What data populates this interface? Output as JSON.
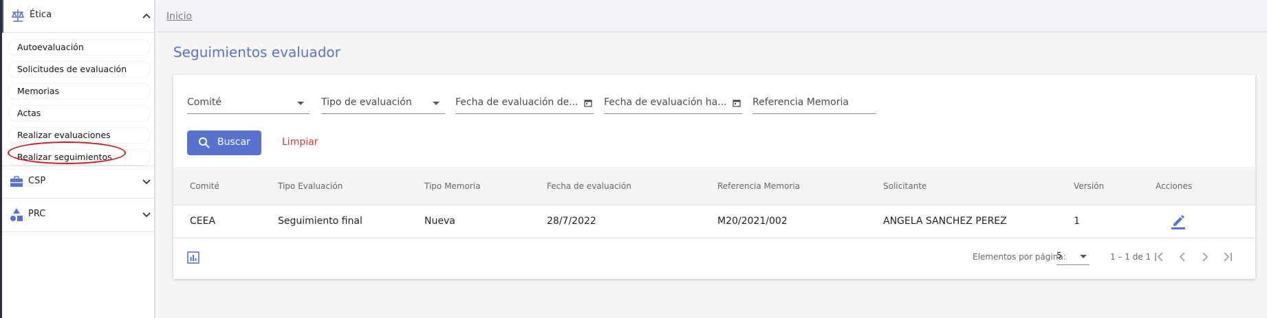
{
  "sidebar": {
    "sections": [
      {
        "label": "Ética",
        "icon": "scales-icon",
        "expanded": true
      },
      {
        "label": "CSP",
        "icon": "briefcase-icon",
        "expanded": false
      },
      {
        "label": "PRC",
        "icon": "shapes-icon",
        "expanded": false
      }
    ],
    "etica_items": [
      {
        "label": "Autoevaluación"
      },
      {
        "label": "Solicitudes de evaluación"
      },
      {
        "label": "Memorias"
      },
      {
        "label": "Actas"
      },
      {
        "label": "Realizar evaluaciones"
      },
      {
        "label": "Realizar seguimientos",
        "highlighted": true
      }
    ]
  },
  "header": {
    "breadcrumb": "Inicio"
  },
  "page": {
    "title": "Seguimientos evaluador"
  },
  "filters": {
    "comite": "Comité",
    "tipo_evaluacion": "Tipo de evaluación",
    "fecha_desde": "Fecha de evaluación de...",
    "fecha_hasta": "Fecha de evaluación ha...",
    "referencia_memoria": "Referencia Memoria"
  },
  "actions": {
    "search_label": "Buscar",
    "clear_label": "Limpiar"
  },
  "table": {
    "columns": [
      "Comité",
      "Tipo Evaluación",
      "Tipo Memoria",
      "Fecha de evaluación",
      "Referencia Memoria",
      "Solicitante",
      "Versión",
      "Acciones"
    ],
    "rows": [
      [
        "CEEA",
        "Seguimiento final",
        "Nueva",
        "28/7/2022",
        "M20/2021/002",
        "ANGELA SANCHEZ PEREZ",
        "1"
      ]
    ]
  },
  "paginator": {
    "items_per_page_label": "Elementos por página:",
    "items_per_page_value": "5",
    "range_label": "1 – 1 de 1"
  },
  "colors": {
    "accent": "#5873cf",
    "title": "#5a72c9",
    "danger": "#d93a2b",
    "highlight_ring": "#d9161b"
  }
}
